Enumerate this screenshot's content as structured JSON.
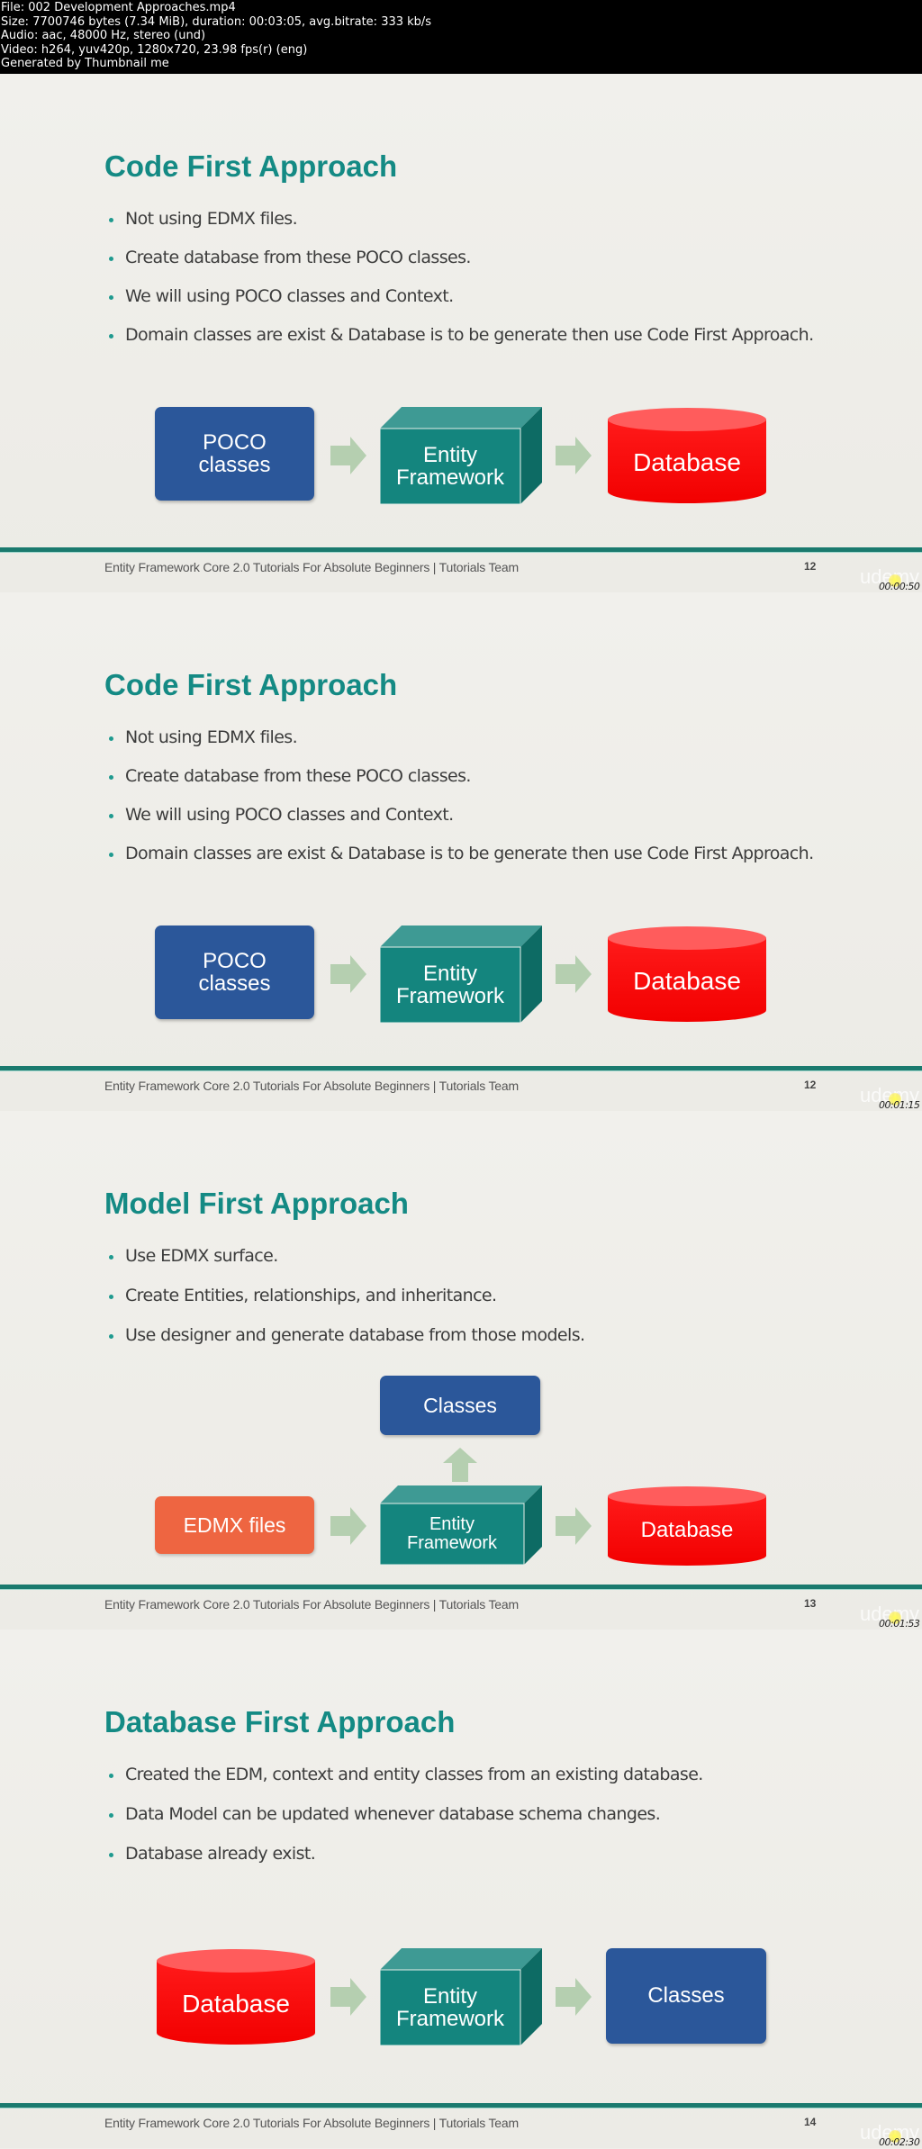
{
  "file_info": {
    "lines": [
      "File: 002 Development Approaches.mp4",
      "Size: 7700746 bytes (7.34 MiB), duration: 00:03:05, avg.bitrate: 333 kb/s",
      "Audio: aac, 48000 Hz, stereo (und)",
      "Video: h264, yuv420p, 1280x720, 23.98 fps(r) (eng)",
      "Generated by Thumbnail me"
    ]
  },
  "colors": {
    "title_teal": "#148a84",
    "rule_teal": "#1a7a6e",
    "classes_blue": "#2b579a",
    "entity_teal": "#14857e",
    "database_red": "#ff1010",
    "edmx_orange": "#ee6541",
    "arrow_green": "#b5cfb0"
  },
  "watermark": "udemy",
  "frames": [
    {
      "title": "Code First Approach",
      "bullets": [
        "Not using EDMX files.",
        "Create database from these POCO classes.",
        "We will using POCO classes and Context.",
        "Domain classes are exist & Database is to be generate then use Code First Approach."
      ],
      "diagram": {
        "poco": [
          "POCO",
          "classes"
        ],
        "entity": [
          "Entity",
          "Framework"
        ],
        "database": "Database"
      },
      "footer": "Entity Framework Core 2.0 Tutorials For Absolute Beginners | Tutorials Team",
      "page": "12",
      "timecode": "00:00:50"
    },
    {
      "title": "Code First Approach",
      "bullets": [
        "Not using EDMX files.",
        "Create database from these POCO classes.",
        "We will using POCO classes and Context.",
        "Domain classes are exist & Database is to be generate then use Code First Approach."
      ],
      "diagram": {
        "poco": [
          "POCO",
          "classes"
        ],
        "entity": [
          "Entity",
          "Framework"
        ],
        "database": "Database"
      },
      "footer": "Entity Framework Core 2.0 Tutorials For Absolute Beginners | Tutorials Team",
      "page": "12",
      "timecode": "00:01:15"
    },
    {
      "title": "Model First Approach",
      "bullets": [
        "Use EDMX surface.",
        "Create Entities, relationships, and inheritance.",
        "Use designer and generate database from those models."
      ],
      "diagram": {
        "classes": "Classes",
        "edmx": "EDMX files",
        "entity": [
          "Entity",
          "Framework"
        ],
        "database": "Database"
      },
      "footer": "Entity Framework Core 2.0 Tutorials For Absolute Beginners | Tutorials Team",
      "page": "13",
      "timecode": "00:01:53"
    },
    {
      "title": "Database First Approach",
      "bullets": [
        "Created the EDM, context and entity classes from an existing database.",
        "Data Model can be updated whenever database schema changes.",
        "Database already exist."
      ],
      "diagram": {
        "database": "Database",
        "entity": [
          "Entity",
          "Framework"
        ],
        "classes": "Classes"
      },
      "footer": "Entity Framework Core 2.0 Tutorials For Absolute Beginners | Tutorials Team",
      "page": "14",
      "timecode": "00:02:30"
    }
  ]
}
